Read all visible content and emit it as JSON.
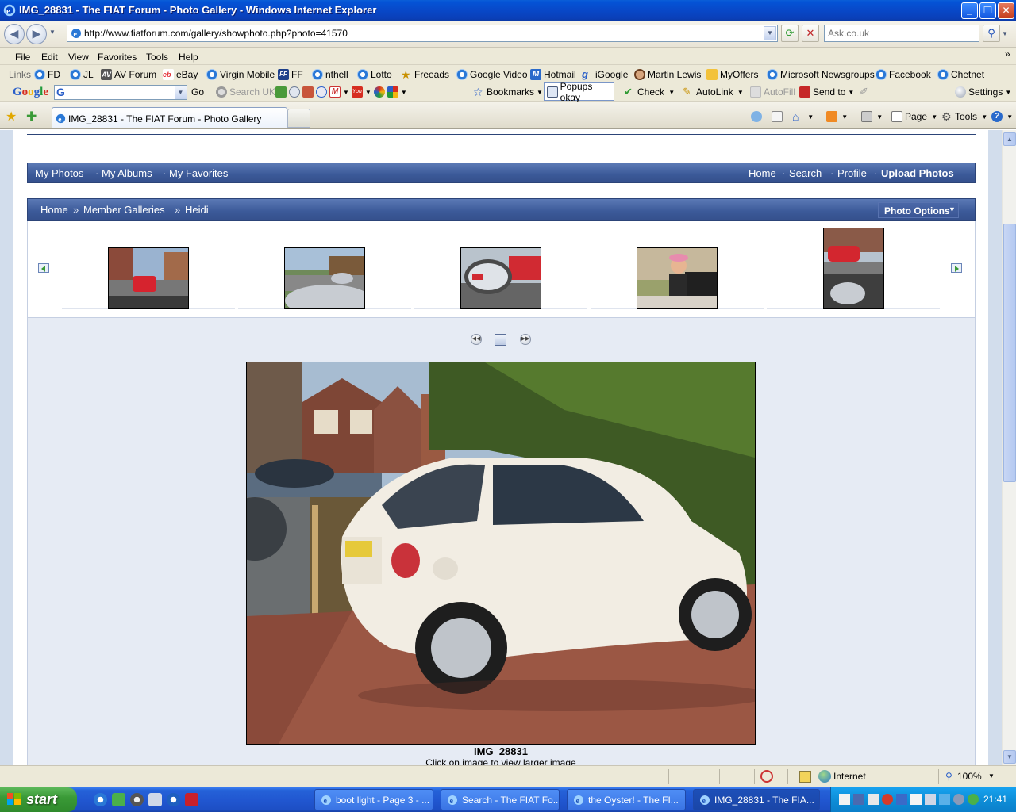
{
  "window": {
    "title": "IMG_28831 - The FIAT Forum - Photo Gallery - Windows Internet Explorer"
  },
  "address_bar": {
    "url": "http://www.fiatforum.com/gallery/showphoto.php?photo=41570",
    "search_placeholder": "Ask.co.uk"
  },
  "menu": {
    "items": [
      "File",
      "Edit",
      "View",
      "Favorites",
      "Tools",
      "Help"
    ]
  },
  "links_bar": {
    "label": "Links",
    "items": [
      "FD",
      "JL",
      "AV Forum",
      "eBay",
      "Virgin Mobile",
      "FF",
      "nthell",
      "Lotto",
      "Freeads",
      "Google Video",
      "Hotmail",
      "iGoogle",
      "Martin Lewis",
      "MyOffers",
      "Microsoft Newsgroups",
      "Facebook",
      "Chetnet"
    ]
  },
  "google_toolbar": {
    "logo": "Google",
    "go": "Go",
    "search_uk": "Search UK",
    "bookmarks": "Bookmarks",
    "popups": "Popups okay",
    "check": "Check",
    "autolink": "AutoLink",
    "autofill": "AutoFill",
    "sendto": "Send to",
    "settings": "Settings"
  },
  "tabs": {
    "active": "IMG_28831 - The FIAT Forum - Photo Gallery"
  },
  "command_bar": {
    "page": "Page",
    "tools": "Tools"
  },
  "gallery": {
    "user_nav": [
      "My Photos",
      "My Albums",
      "My Favorites"
    ],
    "site_nav": [
      "Home",
      "Search",
      "Profile",
      "Upload Photos"
    ],
    "breadcrumb": [
      "Home",
      "Member Galleries",
      "Heidi"
    ],
    "breadcrumb_sep": "»",
    "nav_sep": "·",
    "photo_options": "Photo Options",
    "photo_title": "IMG_28831",
    "photo_hint": "Click on image to view larger image"
  },
  "status_bar": {
    "zone": "Internet",
    "zoom": "100%"
  },
  "taskbar": {
    "start": "start",
    "items": [
      "boot light - Page 3 - ...",
      "Search - The FIAT Fo...",
      "the Oyster! - The FI...",
      "IMG_28831 - The FIA..."
    ],
    "clock": "21:41"
  }
}
